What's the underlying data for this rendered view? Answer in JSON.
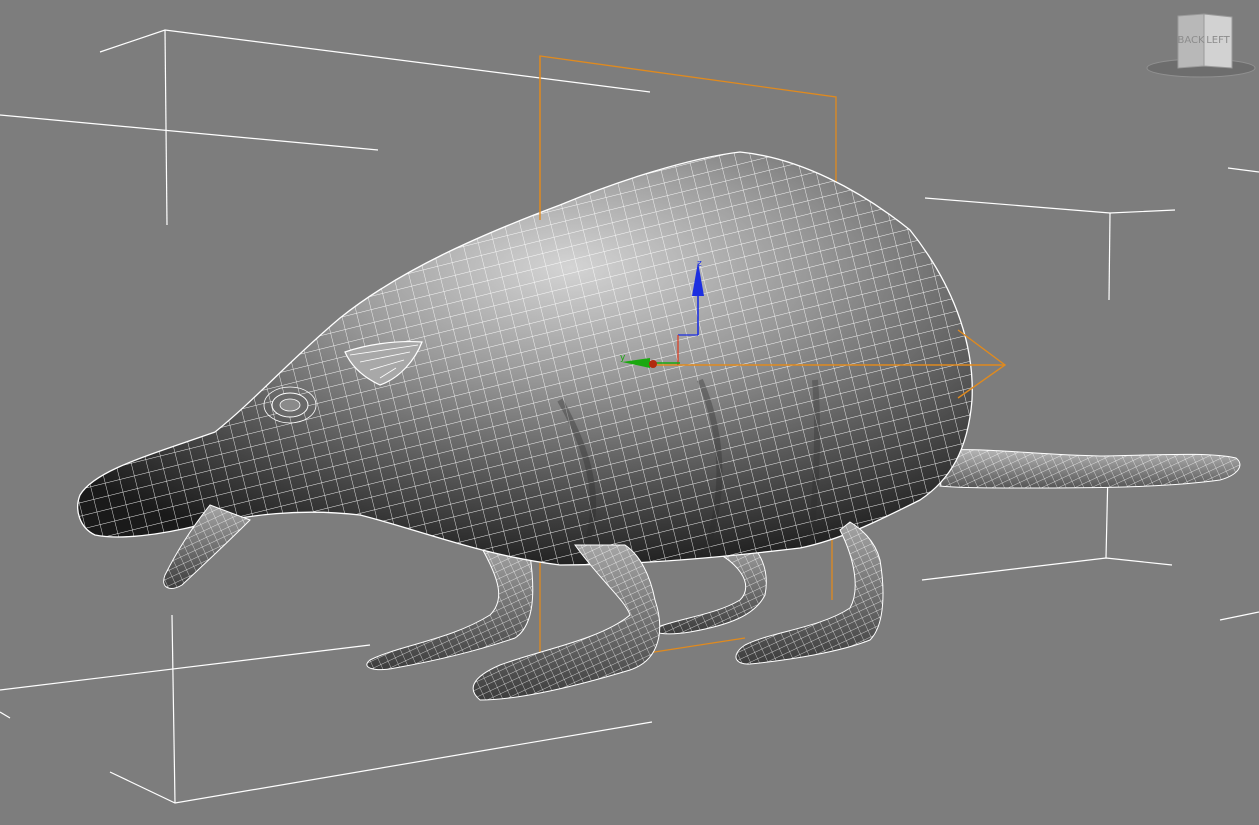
{
  "viewport": {
    "background": "#7d7d7d",
    "selection_color": "#e08a1e",
    "gizmo": {
      "z_label": "z",
      "y_label": "y",
      "x_color": "#e08a1e",
      "y_color": "#1aa80f",
      "z_color": "#1c2fe0"
    }
  },
  "viewcube": {
    "back_label": "BACK",
    "left_label": "LEFT"
  }
}
